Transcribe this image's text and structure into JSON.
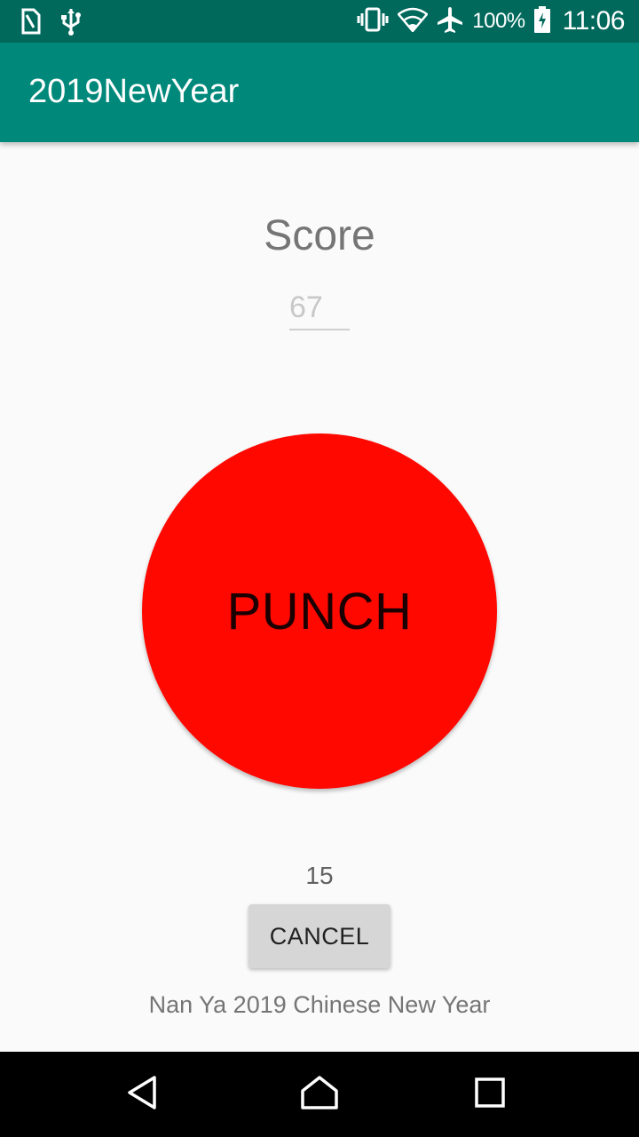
{
  "status_bar": {
    "battery": "100%",
    "time": "11:06",
    "icons": [
      "sim-icon",
      "usb-icon",
      "vibrate-icon",
      "wifi-icon",
      "airplane-icon",
      "battery-icon"
    ]
  },
  "app_bar": {
    "title": "2019NewYear"
  },
  "main": {
    "score_label": "Score",
    "score_value": "67",
    "punch_label": "PUNCH",
    "counter": "15",
    "cancel_label": "CANCEL",
    "footer": "Nan Ya 2019 Chinese New Year"
  },
  "nav_bar": {
    "icons": [
      "back-icon",
      "home-icon",
      "recents-icon"
    ]
  },
  "colors": {
    "status_bar": "#00695c",
    "app_bar": "#00897b",
    "punch": "#ff0800",
    "cancel": "#d6d6d6"
  }
}
